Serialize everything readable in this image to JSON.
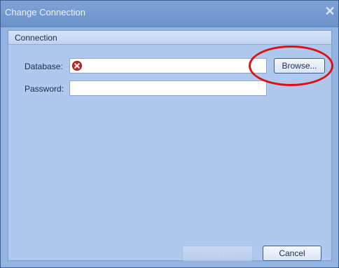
{
  "window": {
    "title": "Change Connection",
    "close_icon": "close-icon"
  },
  "group": {
    "title": "Connection"
  },
  "fields": {
    "database_label": "Database:",
    "database_value": "",
    "database_status_icon": "error-icon",
    "password_label": "Password:",
    "password_value": ""
  },
  "buttons": {
    "browse_label": "Browse...",
    "change_label": "Change",
    "cancel_label": "Cancel"
  },
  "annotation": {
    "highlight_color": "#e01010"
  }
}
